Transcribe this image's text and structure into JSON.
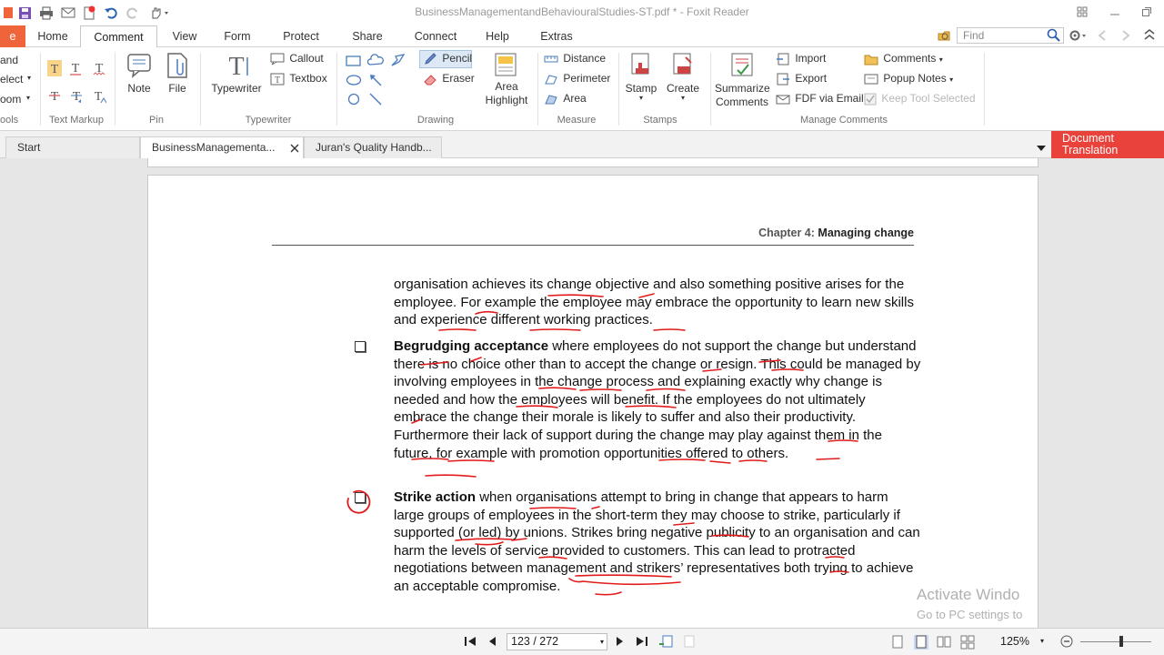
{
  "window": {
    "title": "BusinessManagementandBehaviouralStudies-ST.pdf * - Foxit Reader"
  },
  "ribbon_tabs": [
    {
      "label": "Home"
    },
    {
      "label": "Comment"
    },
    {
      "label": "View"
    },
    {
      "label": "Form"
    },
    {
      "label": "Protect"
    },
    {
      "label": "Share"
    },
    {
      "label": "Connect"
    },
    {
      "label": "Help"
    },
    {
      "label": "Extras"
    }
  ],
  "search": {
    "placeholder": "Find"
  },
  "ribbon": {
    "tools_partial": [
      "and",
      "elect",
      "oom"
    ],
    "groups": {
      "tools": "ools",
      "text_markup": "Text Markup",
      "pin": "Pin",
      "typewriter": "Typewriter",
      "drawing": "Drawing",
      "measure": "Measure",
      "stamps": "Stamps",
      "manage_comments": "Manage Comments"
    },
    "pin": {
      "note": "Note",
      "file": "File"
    },
    "typewriter": {
      "typewriter": "Typewriter",
      "callout": "Callout",
      "textbox": "Textbox"
    },
    "drawing": {
      "pencil": "Pencil",
      "eraser": "Eraser",
      "area_highlight_1": "Area",
      "area_highlight_2": "Highlight"
    },
    "measure": {
      "distance": "Distance",
      "perimeter": "Perimeter",
      "area": "Area"
    },
    "stamps": {
      "stamp": "Stamp",
      "create": "Create"
    },
    "manage": {
      "summarize_1": "Summarize",
      "summarize_2": "Comments",
      "import": "Import",
      "export": "Export",
      "fdf": "FDF via Email",
      "comments": "Comments",
      "popup_notes": "Popup Notes",
      "keep_tool": "Keep Tool Selected"
    }
  },
  "doc_tabs": [
    {
      "label": "Start"
    },
    {
      "label": "BusinessManagementa..."
    },
    {
      "label": "Juran's Quality Handb..."
    }
  ],
  "doc_translation": {
    "line1": "Document",
    "line2": "Translation"
  },
  "page": {
    "chapter_prefix": "Chapter 4:",
    "chapter_title": "Managing change",
    "para1": "organisation achieves its change objective and also something positive arises for the employee. For example the employee may embrace the opportunity to learn new skills and experience different working practices.",
    "para2_head": "Begrudging acceptance",
    "para2_body": " where employees do not support the change but understand there is no choice other than to accept the change or resign. This could be managed by involving employees in the change process and explaining exactly why change is needed and how the employees will benefit. If the employees do not ultimately embrace the change their morale is likely to suffer and also their productivity. Furthermore their lack of support during the change may play against them in the future, for example with promotion opportunities offered to others.",
    "para3_head": "Strike action",
    "para3_body": " when organisations attempt to bring in change that appears to harm large groups of employees in the short-term they may choose to strike, particularly if supported (or led) by unions. Strikes bring negative publicity to an organisation and can harm the levels of service provided to customers. This can lead to protracted negotiations between management and strikers’ representatives both trying to achieve an acceptable compromise."
  },
  "watermark": {
    "line1": "Activate Windo",
    "line2": "Go to PC settings to"
  },
  "status": {
    "page_indicator": "123 / 272",
    "zoom": "125%"
  },
  "colors": {
    "accent": "#f0643c",
    "translation": "#e8423a",
    "annotation": "#e11b1b"
  }
}
